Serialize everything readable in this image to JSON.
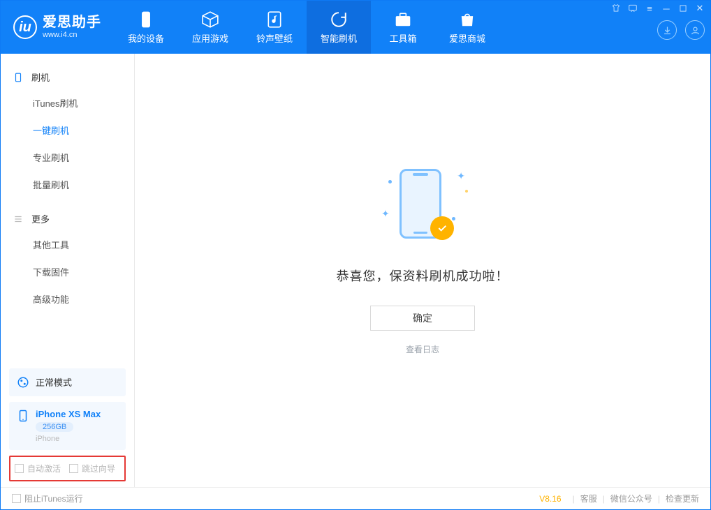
{
  "brand": {
    "title": "爱思助手",
    "subtitle": "www.i4.cn",
    "logo_letter": "iu"
  },
  "nav": {
    "items": [
      {
        "label": "我的设备"
      },
      {
        "label": "应用游戏"
      },
      {
        "label": "铃声壁纸"
      },
      {
        "label": "智能刷机"
      },
      {
        "label": "工具箱"
      },
      {
        "label": "爱思商城"
      }
    ],
    "active_index": 3
  },
  "sidebar": {
    "cat1": "刷机",
    "items1": [
      "iTunes刷机",
      "一键刷机",
      "专业刷机",
      "批量刷机"
    ],
    "cat2": "更多",
    "items2": [
      "其他工具",
      "下载固件",
      "高级功能"
    ],
    "active_item": "一键刷机",
    "mode_label": "正常模式",
    "device": {
      "name": "iPhone XS Max",
      "capacity": "256GB",
      "type": "iPhone"
    },
    "check_auto_activate": "自动激活",
    "check_skip_guide": "跳过向导"
  },
  "main": {
    "message": "恭喜您，保资料刷机成功啦！",
    "ok_button": "确定",
    "view_log": "查看日志"
  },
  "footer": {
    "block_itunes": "阻止iTunes运行",
    "version": "V8.16",
    "links": [
      "客服",
      "微信公众号",
      "检查更新"
    ]
  }
}
